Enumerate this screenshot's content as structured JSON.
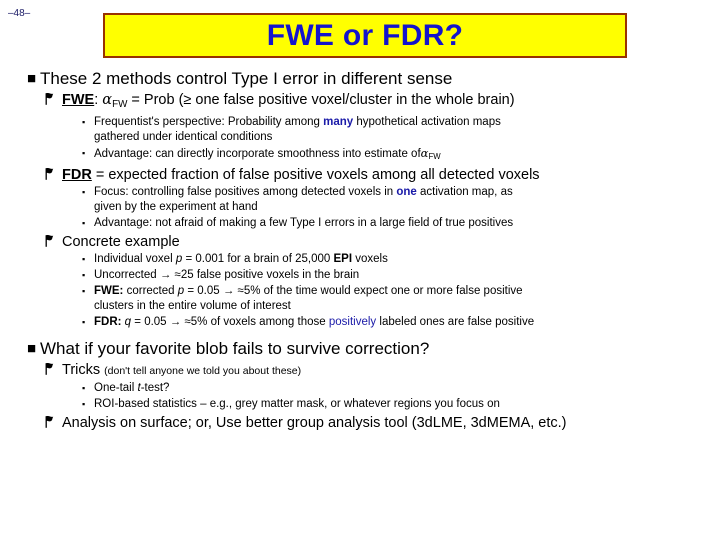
{
  "slide": {
    "page_number": "–48–",
    "title": "FWE or FDR?",
    "colors": {
      "title_box_fill": "#ffff00",
      "title_box_border": "#993300",
      "title_text": "#1414cc",
      "accent_blue": "#1a1aa8",
      "body_text": "#000000",
      "page_number": "#1a1a66"
    }
  },
  "bullets": {
    "b1": "These 2 methods control Type I error in different sense",
    "fwe": {
      "label": "FWE",
      "colon": ":",
      "alpha": "α",
      "alpha_sub": "FW",
      "rest": "= Prob (≥ one false positive voxel/cluster in the whole brain)"
    },
    "fwe_sub1_a": "Frequentist's perspective: Probability among",
    "fwe_sub1_em": "many",
    "fwe_sub1_b": "hypothetical activation maps",
    "fwe_sub1_line2": "gathered under identical conditions",
    "fwe_sub2_a": "Advantage: can directly incorporate smoothness into estimate of",
    "fwe_sub2_alpha": "α",
    "fwe_sub2_alpha_sub": "FW",
    "fdr": {
      "label": "FDR",
      "rest": "= expected fraction of false positive voxels among all detected voxels"
    },
    "fdr_sub1_a": "Focus: controlling false positives among detected voxels in",
    "fdr_sub1_em": "one",
    "fdr_sub1_b": "activation map, as",
    "fdr_sub1_line2": "given by the experiment at hand",
    "fdr_sub2": "Advantage: not afraid of making a few Type I errors in a large field of true positives",
    "concrete": "Concrete example",
    "ex1_a": "Individual voxel",
    "ex1_p": "p",
    "ex1_b": "= 0.001 for a brain of 25,000",
    "ex1_epi": "EPI",
    "ex1_c": "voxels",
    "ex2": "Uncorrected → ≈25 false positive voxels in the brain",
    "ex3_label": "FWE:",
    "ex3_a": "corrected",
    "ex3_p": "p",
    "ex3_b": "= 0.05 → ≈5% of the time would expect one or more false positive",
    "ex3_line2": "clusters in the entire volume of interest",
    "ex4_label": "FDR:",
    "ex4_q": "q",
    "ex4_a": "= 0.05 → ≈5% of voxels among those",
    "ex4_em": "positively",
    "ex4_b": "labeled ones are false positive",
    "b2": "What if your favorite blob fails to survive correction?",
    "tricks_label": "Tricks",
    "tricks_note": "(don't tell anyone we told you about these)",
    "trick1_a": "One-tail",
    "trick1_t": "t",
    "trick1_b": "-test?",
    "trick2_roi": "ROI",
    "trick2_rest": "-based statistics – e.g., grey matter mask, or whatever regions you focus on",
    "last": "Analysis on surface; or, Use better group analysis tool (3dLME, 3dMEMA, etc.)"
  },
  "icons": {
    "bullet_level1": "■",
    "bullet_level2": "flag-marker",
    "bullet_level3": "▪"
  }
}
